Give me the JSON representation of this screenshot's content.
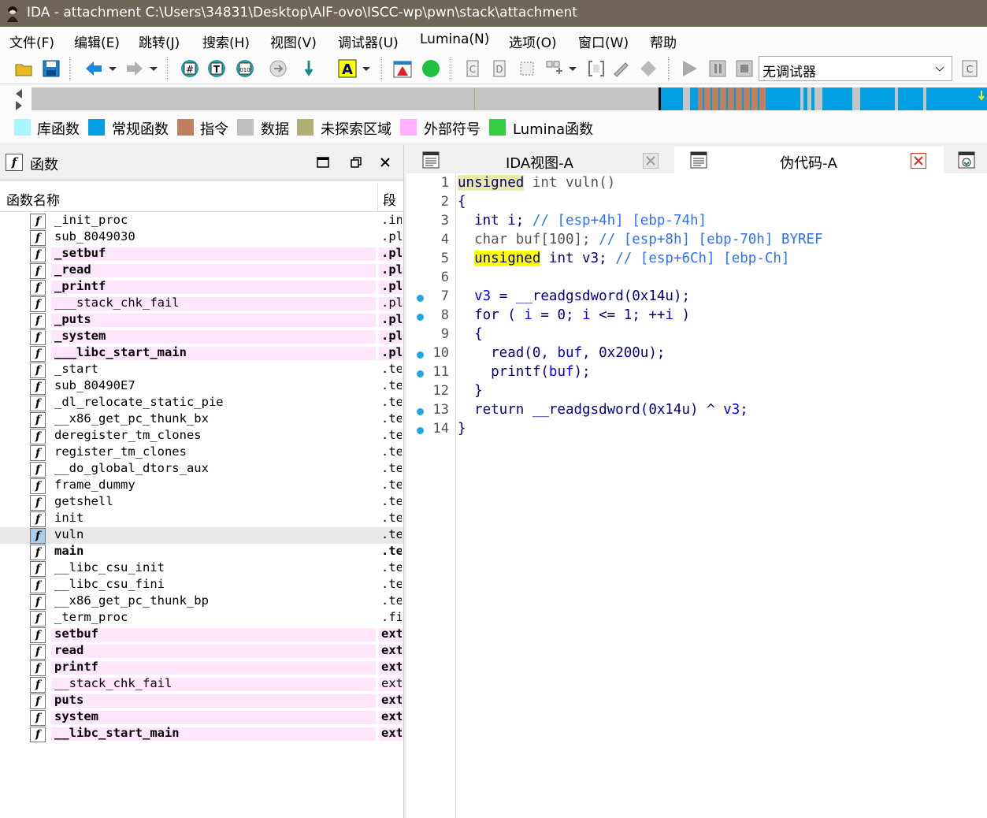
{
  "window": {
    "title": "IDA - attachment C:\\Users\\34831\\Desktop\\AlF-ovo\\ISCC-wp\\pwn\\stack\\attachment"
  },
  "menu": [
    "文件(F)",
    "编辑(E)",
    "跳转(J)",
    "搜索(H)",
    "视图(V)",
    "调试器(U)",
    "Lumina(N)",
    "选项(O)",
    "窗口(W)",
    "帮助"
  ],
  "toolbar": {
    "debugger_selected": "无调试器"
  },
  "legend": [
    {
      "label": "库函数",
      "color": "#aaf6ff"
    },
    {
      "label": "常规函数",
      "color": "#009fe3"
    },
    {
      "label": "指令",
      "color": "#c08060"
    },
    {
      "label": "数据",
      "color": "#c0c0c0"
    },
    {
      "label": "未探索区域",
      "color": "#b0b070"
    },
    {
      "label": "外部符号",
      "color": "#ffb0ff"
    },
    {
      "label": "Lumina函数",
      "color": "#30d040"
    }
  ],
  "functions_panel": {
    "title": "函数",
    "col_name": "函数名称",
    "col_segment": "段",
    "rows": [
      {
        "name": "_init_proc",
        "seg": ".in",
        "bold": false,
        "pink": false
      },
      {
        "name": "sub_8049030",
        "seg": ".pl",
        "bold": false,
        "pink": false
      },
      {
        "name": "_setbuf",
        "seg": ".pl",
        "bold": true,
        "pink": true
      },
      {
        "name": "_read",
        "seg": ".pl",
        "bold": true,
        "pink": true
      },
      {
        "name": "_printf",
        "seg": ".pl",
        "bold": true,
        "pink": true
      },
      {
        "name": "___stack_chk_fail",
        "seg": ".pl",
        "bold": false,
        "pink": true
      },
      {
        "name": "_puts",
        "seg": ".pl",
        "bold": true,
        "pink": true
      },
      {
        "name": "_system",
        "seg": ".pl",
        "bold": true,
        "pink": true
      },
      {
        "name": "___libc_start_main",
        "seg": ".pl",
        "bold": true,
        "pink": true
      },
      {
        "name": "_start",
        "seg": ".te",
        "bold": false,
        "pink": false
      },
      {
        "name": "sub_80490E7",
        "seg": ".te",
        "bold": false,
        "pink": false
      },
      {
        "name": "_dl_relocate_static_pie",
        "seg": ".te",
        "bold": false,
        "pink": false
      },
      {
        "name": "__x86_get_pc_thunk_bx",
        "seg": ".te",
        "bold": false,
        "pink": false
      },
      {
        "name": "deregister_tm_clones",
        "seg": ".te",
        "bold": false,
        "pink": false
      },
      {
        "name": "register_tm_clones",
        "seg": ".te",
        "bold": false,
        "pink": false
      },
      {
        "name": "__do_global_dtors_aux",
        "seg": ".te",
        "bold": false,
        "pink": false
      },
      {
        "name": "frame_dummy",
        "seg": ".te",
        "bold": false,
        "pink": false
      },
      {
        "name": "getshell",
        "seg": ".te",
        "bold": false,
        "pink": false
      },
      {
        "name": "init",
        "seg": ".te",
        "bold": false,
        "pink": false
      },
      {
        "name": "vuln",
        "seg": ".te",
        "bold": false,
        "pink": false,
        "selected": true
      },
      {
        "name": "main",
        "seg": ".te",
        "bold": true,
        "pink": false
      },
      {
        "name": "__libc_csu_init",
        "seg": ".te",
        "bold": false,
        "pink": false
      },
      {
        "name": "__libc_csu_fini",
        "seg": ".te",
        "bold": false,
        "pink": false
      },
      {
        "name": "__x86_get_pc_thunk_bp",
        "seg": ".te",
        "bold": false,
        "pink": false
      },
      {
        "name": "_term_proc",
        "seg": ".fi",
        "bold": false,
        "pink": false
      },
      {
        "name": "setbuf",
        "seg": "ext",
        "bold": true,
        "pink": true
      },
      {
        "name": "read",
        "seg": "ext",
        "bold": true,
        "pink": true
      },
      {
        "name": "printf",
        "seg": "ext",
        "bold": true,
        "pink": true
      },
      {
        "name": "__stack_chk_fail",
        "seg": "ext",
        "bold": false,
        "pink": true
      },
      {
        "name": "puts",
        "seg": "ext",
        "bold": true,
        "pink": true
      },
      {
        "name": "system",
        "seg": "ext",
        "bold": true,
        "pink": true
      },
      {
        "name": "__libc_start_main",
        "seg": "ext",
        "bold": true,
        "pink": true
      }
    ]
  },
  "tabs": [
    {
      "label": "IDA视图-A"
    },
    {
      "label": "伪代码-A"
    }
  ],
  "code": {
    "line_numbers": [
      "1",
      "2",
      "3",
      "4",
      "5",
      "6",
      "7",
      "8",
      "9",
      "10",
      "11",
      "12",
      "13",
      "14"
    ],
    "breakpoint_lines": [
      7,
      8,
      10,
      11,
      13,
      14
    ]
  }
}
